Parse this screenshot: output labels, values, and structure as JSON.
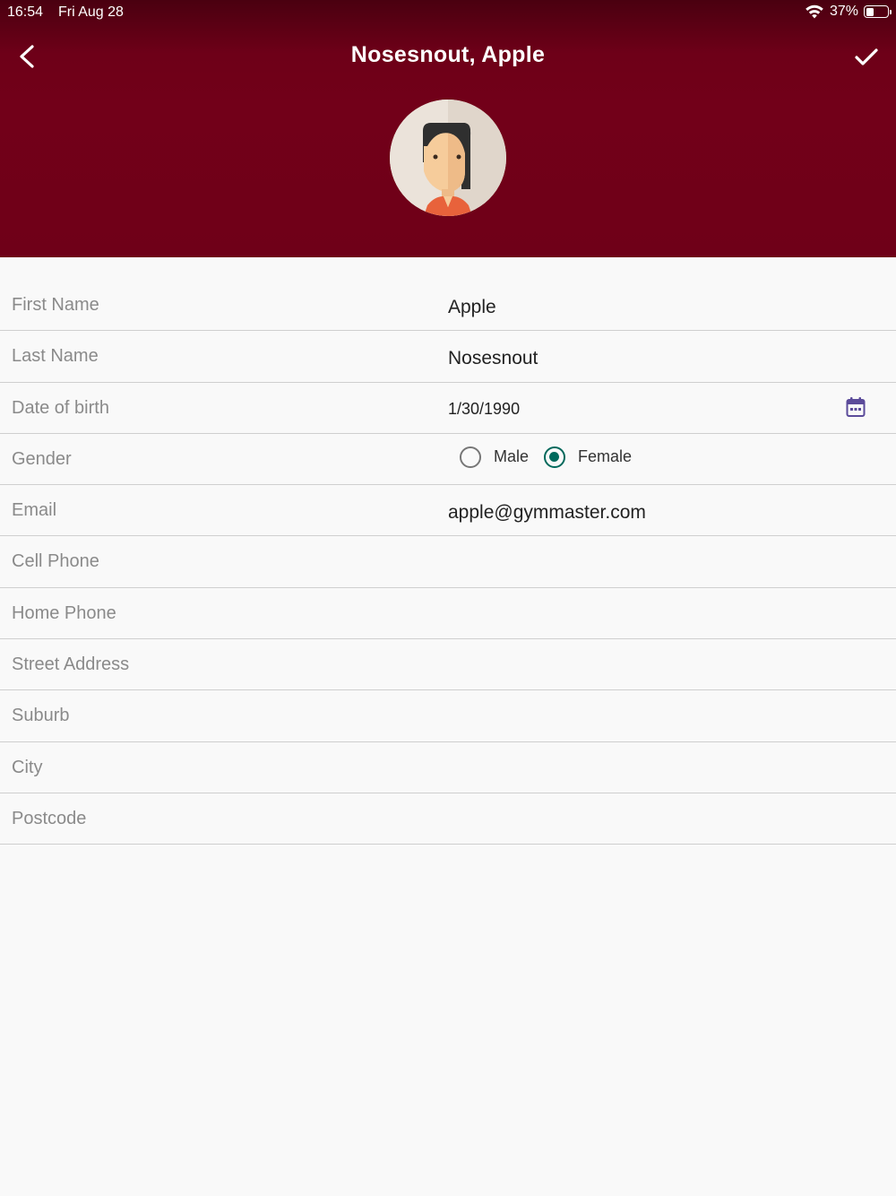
{
  "status_bar": {
    "time": "16:54",
    "date": "Fri Aug 28",
    "battery": "37%",
    "battery_level": 0.37
  },
  "header": {
    "title": "Nosesnout, Apple",
    "back_icon": "chevron-left-icon",
    "save_icon": "checkmark-icon",
    "background_color": "#720019"
  },
  "form": {
    "first_name": {
      "label": "First Name",
      "value": "Apple"
    },
    "last_name": {
      "label": "Last Name",
      "value": "Nosesnout"
    },
    "dob": {
      "label": "Date of birth",
      "value": "1/30/1990",
      "icon": "calendar-icon"
    },
    "gender": {
      "label": "Gender",
      "options": [
        {
          "label": "Male",
          "selected": false
        },
        {
          "label": "Female",
          "selected": true
        }
      ],
      "accent_color": "#00695c"
    },
    "email": {
      "label": "Email",
      "value": "apple@gymmaster.com"
    },
    "cell_phone": {
      "label": "Cell Phone",
      "value": ""
    },
    "home_phone": {
      "label": "Home Phone",
      "value": ""
    },
    "street_address": {
      "label": "Street Address",
      "value": ""
    },
    "suburb": {
      "label": "Suburb",
      "value": ""
    },
    "city": {
      "label": "City",
      "value": ""
    },
    "postcode": {
      "label": "Postcode",
      "value": ""
    }
  }
}
